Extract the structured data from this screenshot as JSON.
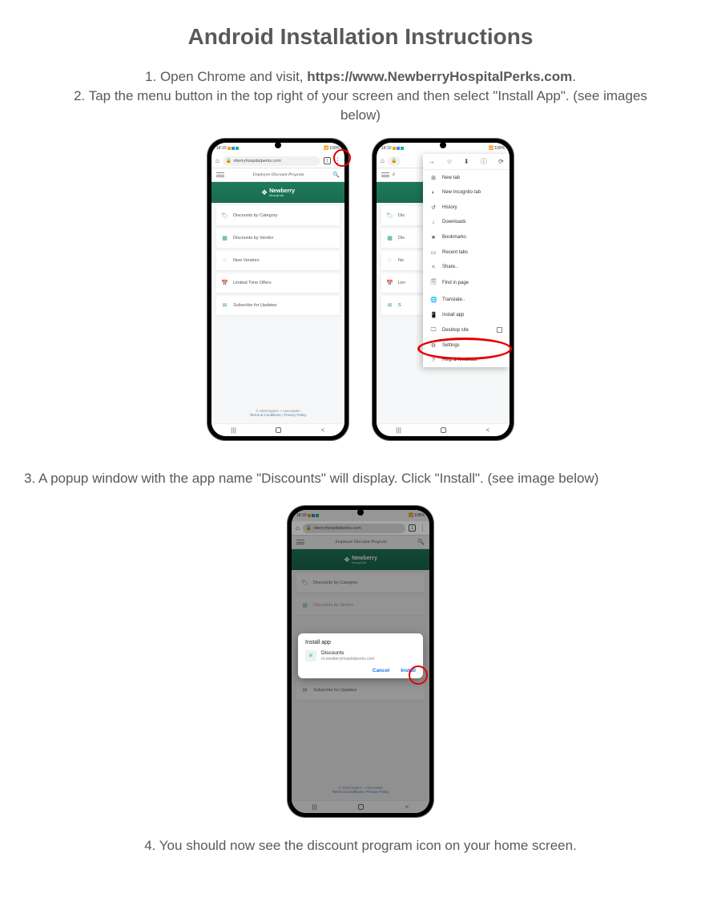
{
  "title": "Android Installation Instructions",
  "step1_prefix": "1. Open Chrome and visit, ",
  "step1_url": "https://www.NewberryHospitalPerks.com",
  "step1_suffix": ".",
  "step2": "2. Tap the menu button in the top right of your screen and then select \"Install App\".  (see images below)",
  "step3": "3. A popup window with the app name \"Discounts\" will display. Click \"Install\". (see image below)",
  "step4": "4. You should now see the discount program icon on your home screen.",
  "phone": {
    "status_time": "18:10",
    "status_battery": "100%",
    "url_display": "vberryhospitalperks.com",
    "page_title": "Employee Discount Program",
    "brand_top": "Newberry",
    "brand_bottom": "Hospital",
    "menu": {
      "cat": "Discounts by Category",
      "vendor": "Discounts by Vendor",
      "new": "New Vendors",
      "limited": "Limited Time Offers",
      "subscribe": "Subscribe for Updates"
    },
    "footer_copy": "© 2023 Epkes + Associates",
    "footer_terms": "Terms & Conditions",
    "footer_privacy": "Privacy Policy"
  },
  "chrome_menu": {
    "new_tab": "New tab",
    "incognito": "New Incognito tab",
    "history": "History",
    "downloads": "Downloads",
    "bookmarks": "Bookmarks",
    "recent": "Recent tabs",
    "share": "Share..",
    "find": "Find in page",
    "translate": "Translate..",
    "install": "Install app",
    "desktop": "Desktop site",
    "settings": "Settings",
    "help": "Help & feedback"
  },
  "dialog": {
    "title": "Install app",
    "app_name": "Discounts",
    "app_url": "m.newberryhospitalperks.com",
    "cancel": "Cancel",
    "install": "Install"
  }
}
